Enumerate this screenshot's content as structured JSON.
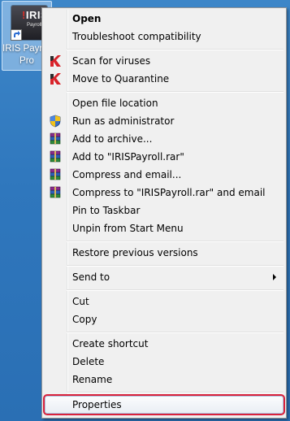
{
  "desktop_icon": {
    "logo": "IRIS",
    "logo_sub": "Payroll",
    "label_line1": "IRIS Payroll",
    "label_line2": "Pro"
  },
  "menu": {
    "open": "Open",
    "troubleshoot": "Troubleshoot compatibility",
    "scan_viruses": "Scan for viruses",
    "move_quarantine": "Move to Quarantine",
    "open_file_location": "Open file location",
    "run_as_admin": "Run as administrator",
    "add_to_archive": "Add to archive...",
    "add_to_rar": "Add to \"IRISPayroll.rar\"",
    "compress_email": "Compress and email...",
    "compress_to_rar_email": "Compress to \"IRISPayroll.rar\" and email",
    "pin_taskbar": "Pin to Taskbar",
    "unpin_start": "Unpin from Start Menu",
    "restore_versions": "Restore previous versions",
    "send_to": "Send to",
    "cut": "Cut",
    "copy": "Copy",
    "create_shortcut": "Create shortcut",
    "delete": "Delete",
    "rename": "Rename",
    "properties": "Properties"
  },
  "colors": {
    "desktop": "#2f77bd",
    "menu_bg": "#f0f0f0",
    "highlight_outline": "#d9223c",
    "kaspersky_red": "#d8232a"
  },
  "icons": {
    "scan_viruses": "kaspersky-icon",
    "move_quarantine": "kaspersky-icon",
    "run_as_admin": "uac-shield-icon",
    "winrar": "winrar-icon",
    "send_to": "chevron-right-icon"
  }
}
